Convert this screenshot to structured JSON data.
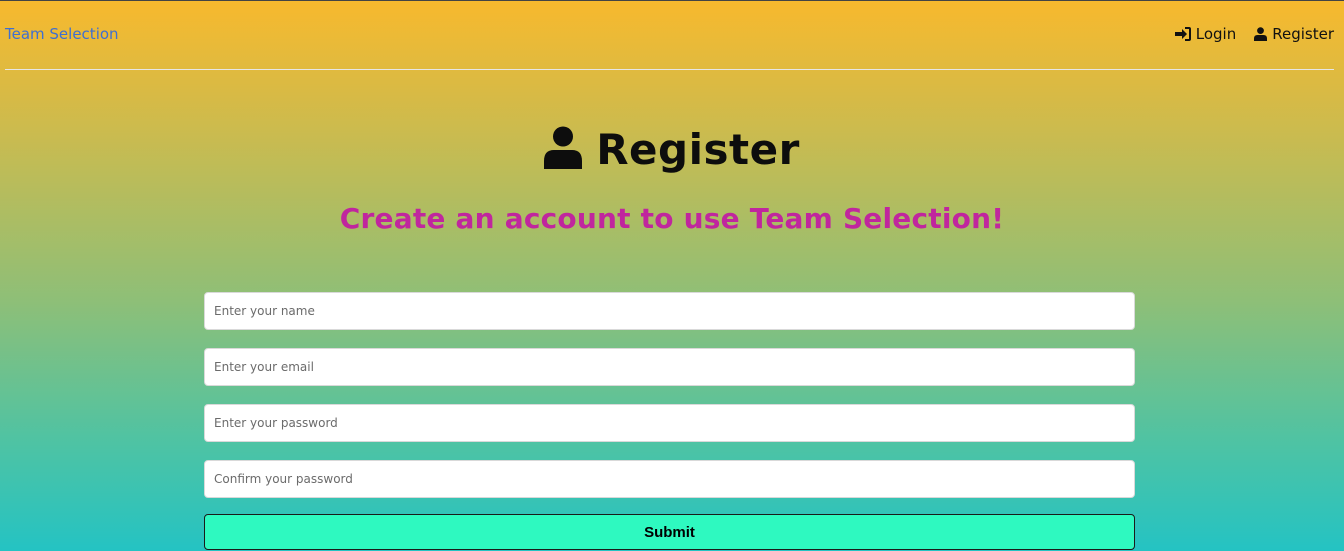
{
  "nav": {
    "brand": "Team Selection",
    "login_label": "Login",
    "register_label": "Register"
  },
  "page": {
    "title": "Register",
    "subtitle": "Create an account to use Team Selection!"
  },
  "form": {
    "name_placeholder": "Enter your name",
    "email_placeholder": "Enter your email",
    "password_placeholder": "Enter your password",
    "confirm_placeholder": "Confirm your password",
    "submit_label": "Submit"
  },
  "icons": {
    "login": "sign-in-icon",
    "register": "user-icon",
    "heading": "user-icon"
  },
  "colors": {
    "brand_link": "#3f6fd1",
    "subtitle": "#c0269e",
    "submit_bg": "#2ef9c0",
    "gradient_top": "#f8b92d",
    "gradient_bottom": "#24c3c3"
  }
}
